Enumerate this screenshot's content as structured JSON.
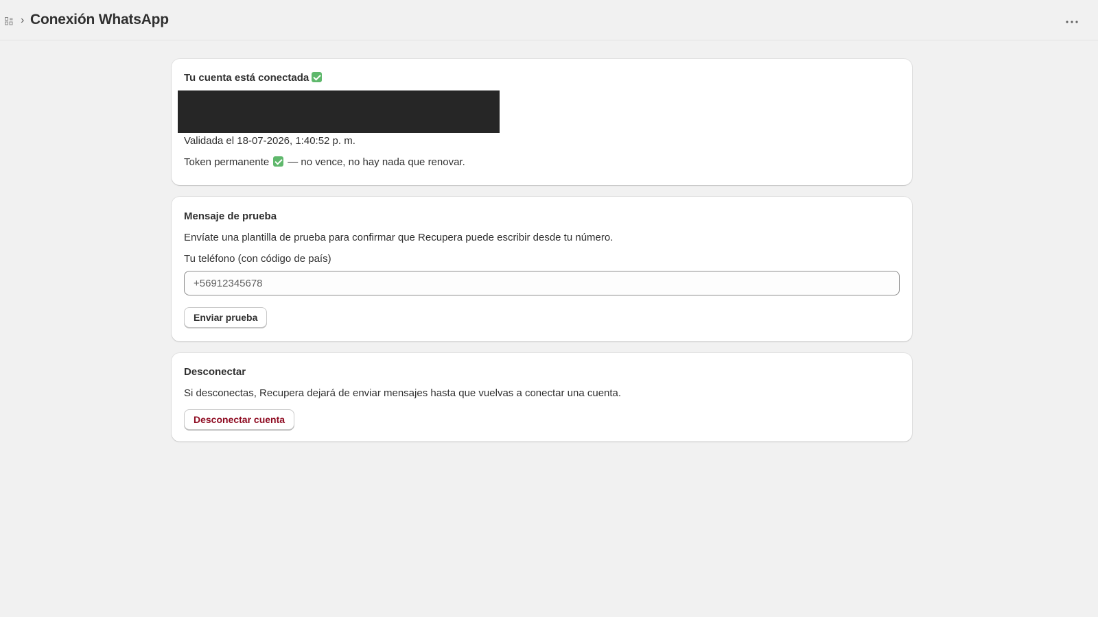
{
  "header": {
    "title": "Conexión WhatsApp",
    "apps_icon": "apps-grid-icon",
    "more_icon": "more-horizontal-icon"
  },
  "connection": {
    "title": "Tu cuenta está conectada",
    "validated": "Validada el 18-07-2026, 1:40:52 p. m.",
    "token_prefix": "Token permanente",
    "token_suffix": "— no vence, no hay nada que renovar."
  },
  "test_message": {
    "title": "Mensaje de prueba",
    "description": "Envíate una plantilla de prueba para confirmar que Recupera puede escribir desde tu número.",
    "phone_label": "Tu teléfono (con código de país)",
    "phone_placeholder": "+56912345678",
    "send_button": "Enviar prueba"
  },
  "disconnect": {
    "title": "Desconectar",
    "description": "Si desconectas, Recupera dejará de enviar mensajes hasta que vuelvas a conectar una cuenta.",
    "button": "Desconectar cuenta"
  },
  "colors": {
    "background": "#f1f1f1",
    "card": "#ffffff",
    "check": "#5fb86c",
    "danger": "#8e0b21"
  }
}
